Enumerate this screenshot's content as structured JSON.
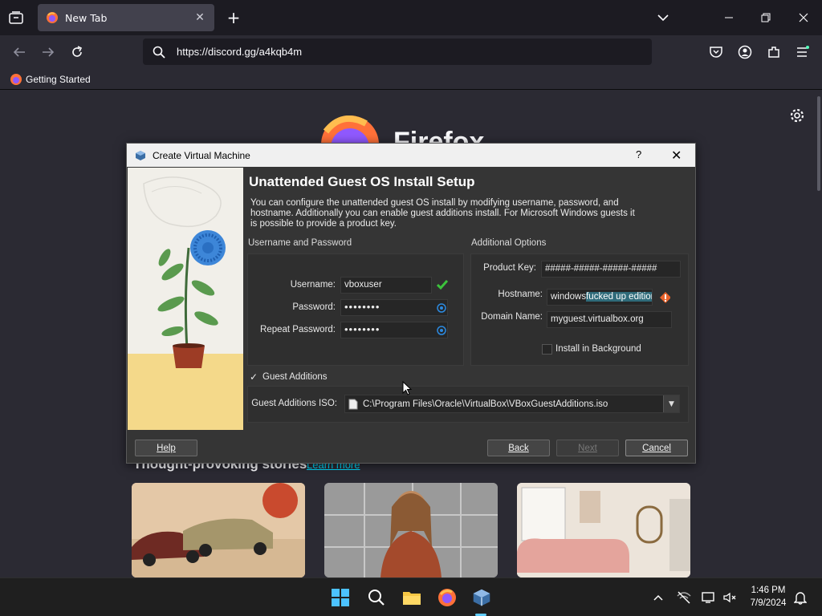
{
  "browser": {
    "tab_title": "New Tab",
    "url": "https://discord.gg/a4kqb4m",
    "bookmark": "Getting Started"
  },
  "newtab_page": {
    "brand_word": "Firefox",
    "stories_heading": "Thought-provoking stories",
    "learn_more": "Learn more"
  },
  "dialog": {
    "window_title": "Create Virtual Machine",
    "help_glyph": "?",
    "heading": "Unattended Guest OS Install Setup",
    "description": "You can configure the unattended guest OS install by modifying username, password, and hostname. Additionally you can enable guest additions install. For Microsoft Windows guests it is possible to provide a product key.",
    "user_section": "Username and Password",
    "username_label": "Username:",
    "username_value": "vboxuser",
    "password_label": "Password:",
    "password_value": "••••••••",
    "repeat_label": "Repeat Password:",
    "repeat_value": "••••••••",
    "options_section": "Additional Options",
    "product_key_label": "Product Key:",
    "product_key_value": "#####-#####-#####-#####",
    "hostname_label": "Hostname:",
    "hostname_value_a": "windows",
    "hostname_value_b": "fucked up edition",
    "domain_label": "Domain Name:",
    "domain_value": "myguest.virtualbox.org",
    "install_bg_label": "Install in Background",
    "guest_additions_label": "Guest Additions",
    "ga_iso_label": "Guest Additions ISO:",
    "ga_iso_value": "C:\\Program Files\\Oracle\\VirtualBox\\VBoxGuestAdditions.iso",
    "help_button": "Help",
    "back_button": "Back",
    "next_button": "Next",
    "cancel_button": "Cancel"
  },
  "taskbar": {
    "time": "1:46 PM",
    "date": "7/9/2024"
  },
  "colors": {
    "accent": "#60cdff",
    "valid": "#3cc33c",
    "warning": "#e8632b"
  }
}
